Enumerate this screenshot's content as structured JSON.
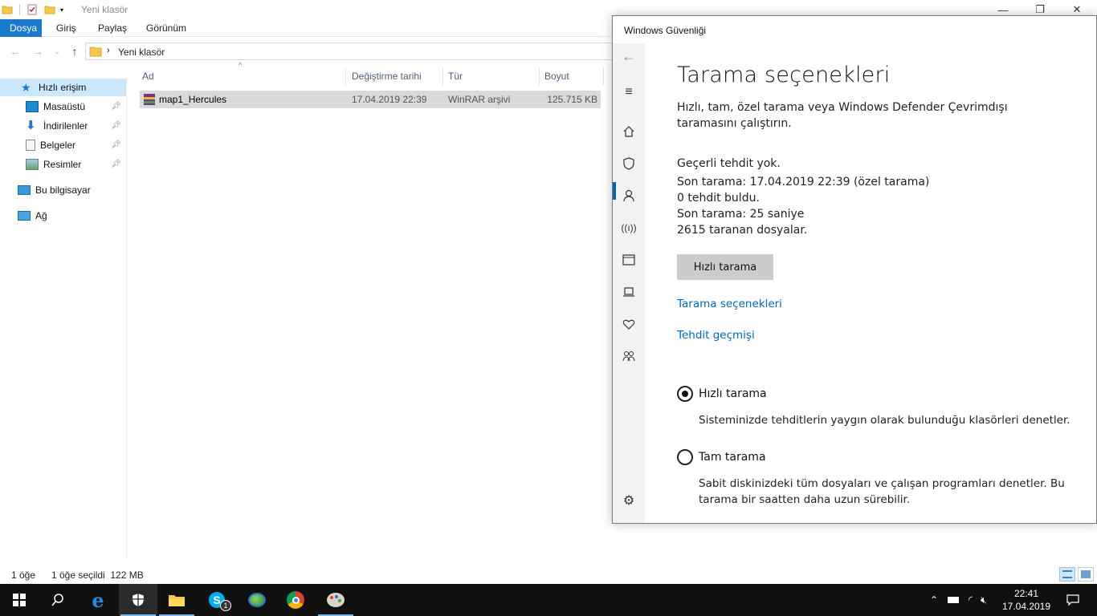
{
  "explorer": {
    "title": "Yeni klasör",
    "tabs": [
      "Dosya",
      "Giriş",
      "Paylaş",
      "Görünüm"
    ],
    "address": "Yeni klasör",
    "sidebar": [
      {
        "label": "Hızlı erişim",
        "icon": "star-icon",
        "pinned": false
      },
      {
        "label": "Masaüstü",
        "icon": "desktop-icon",
        "pinned": true
      },
      {
        "label": "İndirilenler",
        "icon": "download-icon",
        "pinned": true
      },
      {
        "label": "Belgeler",
        "icon": "documents-icon",
        "pinned": true
      },
      {
        "label": "Resimler",
        "icon": "pictures-icon",
        "pinned": true
      },
      {
        "label": "Bu bilgisayar",
        "icon": "computer-icon",
        "pinned": false
      },
      {
        "label": "Ağ",
        "icon": "network-icon",
        "pinned": false
      }
    ],
    "columns": [
      "Ad",
      "Değiştirme tarihi",
      "Tür",
      "Boyut"
    ],
    "files": [
      {
        "name": "map1_Hercules",
        "date": "17.04.2019 22:39",
        "type": "WinRAR arşivi",
        "size": "125.715 KB"
      }
    ],
    "status_count": "1 öğe",
    "status_selected": "1 öğe seçildi  122 MB"
  },
  "security": {
    "window_title": "Windows Güvenliği",
    "heading": "Tarama seçenekleri",
    "intro": "Hızlı, tam, özel tarama veya Windows Defender Çevrimdışı taramasını çalıştırın.",
    "status_lines": [
      "Geçerli tehdit yok.",
      "Son tarama: 17.04.2019 22:39 (özel tarama)",
      "0 tehdit buldu.",
      "Son tarama: 25 saniye",
      "2615 taranan dosyalar."
    ],
    "scan_button": "Hızlı tarama",
    "links": [
      "Tarama seçenekleri",
      "Tehdit geçmişi"
    ],
    "options": [
      {
        "label": "Hızlı tarama",
        "desc": "Sisteminizde tehditlerin yaygın olarak bulunduğu klasörleri denetler.",
        "selected": true
      },
      {
        "label": "Tam tarama",
        "desc": "Sabit diskinizdeki tüm dosyaları ve çalışan programları denetler. Bu tarama bir saatten daha uzun sürebilir.",
        "selected": false
      }
    ]
  },
  "taskbar": {
    "time": "22:41",
    "date": "17.04.2019",
    "skype_badge": "1"
  },
  "colors": {
    "accent": "#0067b8",
    "ribbon_file": "#1979ca",
    "selection": "#cce8ff",
    "taskbar": "#101010"
  }
}
